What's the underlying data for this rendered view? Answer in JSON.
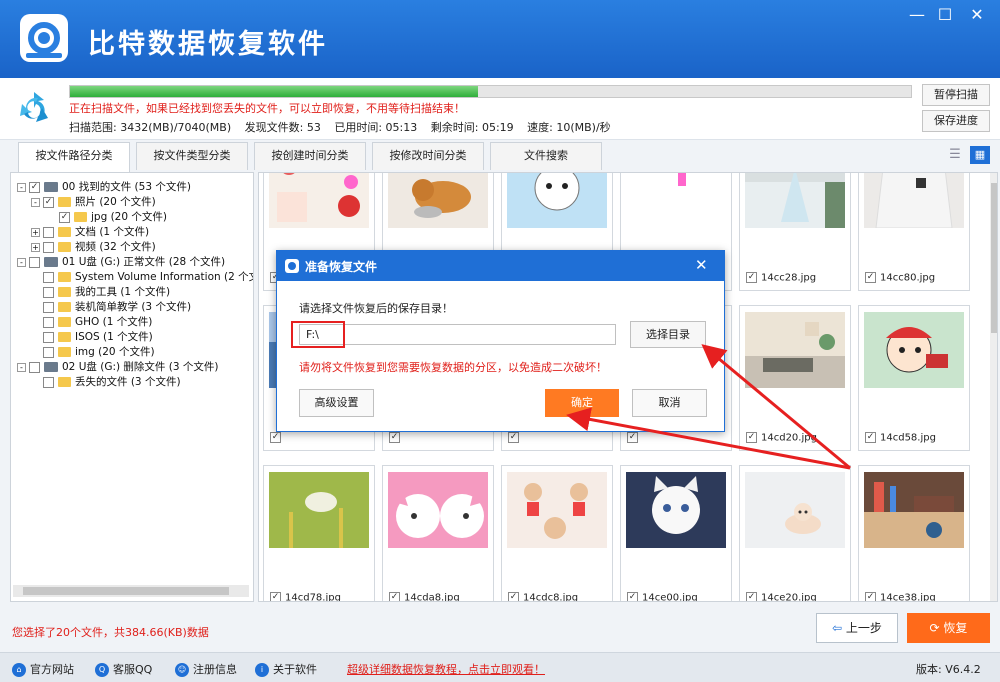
{
  "app": {
    "title": "比特数据恢复软件",
    "win_min": "—",
    "win_max": "☐",
    "win_close": "✕"
  },
  "scan": {
    "progress_fraction": 0.485,
    "message": "正在扫描文件，如果已经找到您丢失的文件，可以立即恢复，不用等待扫描结束！",
    "range": "扫描范围: 3432(MB)/7040(MB)",
    "found": "发现文件数: 53",
    "elapsed": "已用时间: 05:13",
    "remaining": "剩余时间: 05:19",
    "speed": "速度: 10(MB)/秒",
    "pause_label": "暂停扫描",
    "save_label": "保存进度"
  },
  "tabs": [
    "按文件路径分类",
    "按文件类型分类",
    "按创建时间分类",
    "按修改时间分类",
    "文件搜索"
  ],
  "tree": [
    {
      "exp": "-",
      "checked": true,
      "icon": "drive",
      "label": "00 找到的文件  (53 个文件)"
    },
    {
      "exp": "-",
      "checked": true,
      "icon": "folder",
      "label": "照片    (20 个文件)"
    },
    {
      "exp": "",
      "checked": true,
      "icon": "folder",
      "label": "jpg    (20 个文件)"
    },
    {
      "exp": "+",
      "checked": false,
      "icon": "folder",
      "label": "文档    (1 个文件)"
    },
    {
      "exp": "+",
      "checked": false,
      "icon": "folder",
      "label": "视频    (32 个文件)"
    },
    {
      "exp": "-",
      "checked": false,
      "icon": "drive",
      "label": "01 U盘 (G:) 正常文件 (28 个文件)"
    },
    {
      "exp": "",
      "checked": false,
      "icon": "folder",
      "label": "System Volume Information    (2 个文"
    },
    {
      "exp": "",
      "checked": false,
      "icon": "folder",
      "label": "我的工具    (1 个文件)"
    },
    {
      "exp": "",
      "checked": false,
      "icon": "folder",
      "label": "装机简单教学    (3 个文件)"
    },
    {
      "exp": "",
      "checked": false,
      "icon": "folder",
      "label": "GHO    (1 个文件)"
    },
    {
      "exp": "",
      "checked": false,
      "icon": "folder",
      "label": "ISOS    (1 个文件)"
    },
    {
      "exp": "",
      "checked": false,
      "icon": "folder",
      "label": "img    (20 个文件)"
    },
    {
      "exp": "-",
      "checked": false,
      "icon": "drive",
      "label": "02 U盘 (G:) 删除文件 (3 个文件)"
    },
    {
      "exp": "",
      "checked": false,
      "icon": "folder",
      "label": "丢失的文件    (3 个文件)"
    }
  ],
  "grid": {
    "rows": [
      [
        {
          "name": "",
          "thumb": "balloons"
        },
        {
          "name": "",
          "thumb": "cats-eating"
        },
        {
          "name": "",
          "thumb": "cartoon-cat"
        },
        {
          "name": "",
          "thumb": "tiny-figure"
        },
        {
          "name": "14cc28.jpg",
          "thumb": "girl-dress"
        },
        {
          "name": "14cc80.jpg",
          "thumb": "white-shirt"
        }
      ],
      [
        {
          "name": "",
          "thumb": "blue-wall"
        },
        {
          "name": "",
          "thumb": "blank"
        },
        {
          "name": "",
          "thumb": "blank"
        },
        {
          "name": "",
          "thumb": "blank"
        },
        {
          "name": "14cd20.jpg",
          "thumb": "living-room"
        },
        {
          "name": "14cd58.jpg",
          "thumb": "cartoon-boy"
        }
      ],
      [
        {
          "name": "14cd78.jpg",
          "thumb": "butterfly"
        },
        {
          "name": "14cda8.jpg",
          "thumb": "pink-rabbits"
        },
        {
          "name": "14cdc8.jpg",
          "thumb": "cartoon-girls"
        },
        {
          "name": "14ce00.jpg",
          "thumb": "white-cat"
        },
        {
          "name": "14ce20.jpg",
          "thumb": "kitten"
        },
        {
          "name": "14ce38.jpg",
          "thumb": "desk-items"
        }
      ]
    ]
  },
  "dialog": {
    "title": "准备恢复文件",
    "close": "✕",
    "prompt": "请选择文件恢复后的保存目录！",
    "path_value": "F:\\",
    "choose_label": "选择目录",
    "warning": "请勿将文件恢复到您需要恢复数据的分区，以免造成二次破坏！",
    "advanced_label": "高级设置",
    "ok_label": "确定",
    "cancel_label": "取消"
  },
  "actionbar": {
    "selection_info": "您选择了20个文件，共384.66(KB)数据",
    "prev_label": "上一步",
    "recover_label": "恢复"
  },
  "footer": {
    "links": [
      "官方网站",
      "客服QQ",
      "注册信息",
      "关于软件"
    ],
    "tutorial": "超级详细数据恢复教程，点击立即观看！",
    "version": "版本: V6.4.2"
  },
  "colors": {
    "brand_blue": "#1f6fd6",
    "accent_orange": "#ff7a22",
    "warning_red": "#e0201b",
    "annotation_red": "#e62020"
  }
}
